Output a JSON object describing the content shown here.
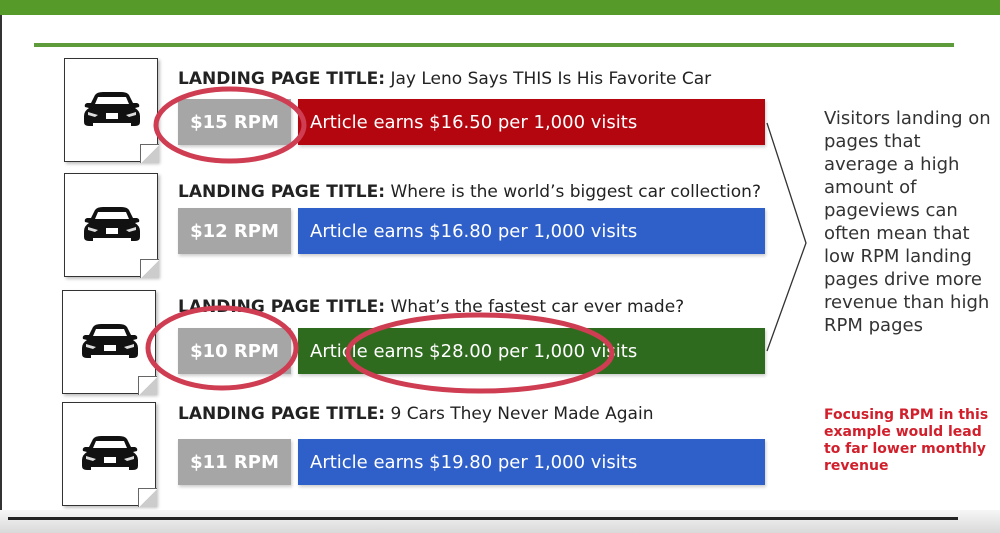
{
  "colors": {
    "top_bar": "#569b2a",
    "rpm_gray": "#a6a6a6",
    "red_bar": "#b3060f",
    "blue_bar": "#2f5fc8",
    "green_bar": "#2f6b1f",
    "highlight_circle": "#cf3d52",
    "note_red": "#d11f2b"
  },
  "rows": [
    {
      "title_label": "LANDING PAGE TITLE:",
      "title_text": "Jay Leno Says THIS Is His Favorite Car",
      "rpm": "$15 RPM",
      "earnings": "Article earns $16.50 per 1,000 visits",
      "bar_color": "red",
      "rpm_circled": true,
      "earnings_circled": false,
      "icon": "car-icon"
    },
    {
      "title_label": "LANDING PAGE TITLE:",
      "title_text": "Where is the world’s biggest car collection?",
      "rpm": "$12 RPM",
      "earnings": "Article earns $16.80 per 1,000 visits",
      "bar_color": "blue",
      "rpm_circled": false,
      "earnings_circled": false,
      "icon": "car-icon"
    },
    {
      "title_label": "LANDING PAGE TITLE:",
      "title_text": "What’s the fastest car ever made?",
      "rpm": "$10 RPM",
      "earnings": "Article earns $28.00 per 1,000 visits",
      "bar_color": "green",
      "rpm_circled": true,
      "earnings_circled": true,
      "icon": "car-icon"
    },
    {
      "title_label": "LANDING PAGE TITLE:",
      "title_text": "9 Cars They Never Made Again",
      "rpm": "$11 RPM",
      "earnings": "Article earns $19.80 per 1,000 visits",
      "bar_color": "blue",
      "rpm_circled": false,
      "earnings_circled": false,
      "icon": "car-icon"
    }
  ],
  "side_text": "Visitors landing on pages that average a high amount of pageviews can often mean that low RPM landing pages drive more revenue than high RPM pages",
  "side_note": "Focusing RPM in this example would lead to far lower monthly revenue"
}
